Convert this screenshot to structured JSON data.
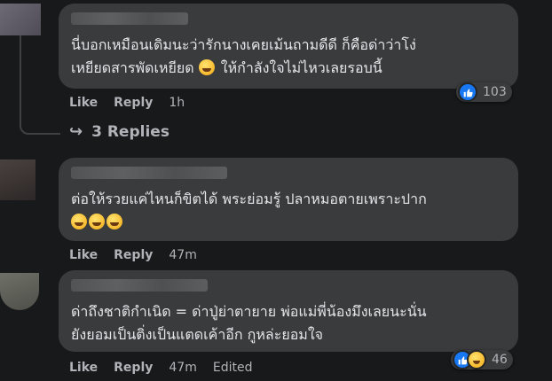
{
  "comments": [
    {
      "text": "นี่บอกเหมือนเดิมนะว่ารักนางเคยเม้นถามดีดี ก็คือด่าว่าโง่\nเหยียดสารพัดเหยียด",
      "text_tail": " ให้กำลังใจไม่ไหวเลยรอบนี้",
      "like": "Like",
      "reply": "Reply",
      "time": "1h",
      "reaction_count": "103",
      "reactions": [
        "like-icon"
      ]
    },
    {
      "text": "ต่อให้รวยแค่ไหนก็ขิตได้ พระย่อมรู้ ปลาหมอตายเพราะปาก",
      "like": "Like",
      "reply": "Reply",
      "time": "47m"
    },
    {
      "text": "ด่าถึงชาติกำเนิด = ด่าปู่ย่าตายาย พ่อแม่พี่น้องมึงเลยนะนั่น\nยังยอมเป็นติ่งเป็นแตดเค้าอีก กูหล่ะยอมใจ",
      "like": "Like",
      "reply": "Reply",
      "time": "47m",
      "edited": "Edited",
      "reaction_count": "46",
      "reactions": [
        "like-icon",
        "haha-icon"
      ]
    }
  ],
  "replies_link": "3 Replies",
  "colors": {
    "bg": "#18191a",
    "bubble": "#3a3b3c",
    "like_blue": "#1877f2",
    "text": "#e4e6eb",
    "muted": "#b0b3b8"
  }
}
